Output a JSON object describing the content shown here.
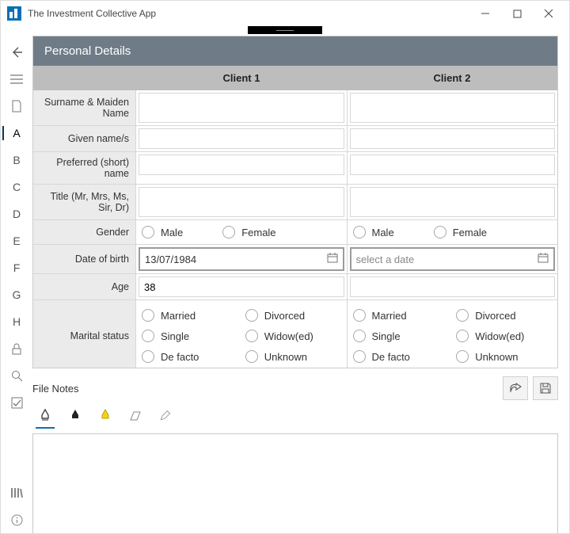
{
  "window": {
    "title": "The Investment Collective App"
  },
  "sidebar": {
    "items": [
      {
        "id": "back",
        "label": "←",
        "kind": "icon"
      },
      {
        "id": "menu",
        "label": "≡",
        "kind": "icon"
      },
      {
        "id": "page",
        "label": "▭",
        "kind": "icon"
      },
      {
        "id": "a",
        "label": "A",
        "kind": "letter",
        "selected": true
      },
      {
        "id": "b",
        "label": "B",
        "kind": "letter"
      },
      {
        "id": "c",
        "label": "C",
        "kind": "letter"
      },
      {
        "id": "d",
        "label": "D",
        "kind": "letter"
      },
      {
        "id": "e",
        "label": "E",
        "kind": "letter"
      },
      {
        "id": "f",
        "label": "F",
        "kind": "letter"
      },
      {
        "id": "g",
        "label": "G",
        "kind": "letter"
      },
      {
        "id": "h",
        "label": "H",
        "kind": "letter"
      },
      {
        "id": "lock",
        "label": "lock",
        "kind": "icon"
      },
      {
        "id": "search",
        "label": "search",
        "kind": "icon"
      },
      {
        "id": "check",
        "label": "check",
        "kind": "icon"
      },
      {
        "id": "books",
        "label": "books",
        "kind": "icon",
        "footer": true
      },
      {
        "id": "info",
        "label": "info",
        "kind": "icon",
        "footer": true
      }
    ]
  },
  "section": {
    "title": "Personal Details"
  },
  "columns": {
    "label": "",
    "c1": "Client 1",
    "c2": "Client 2"
  },
  "rows": {
    "surname": {
      "label": "Surname & Maiden Name",
      "c1": "",
      "c2": ""
    },
    "given": {
      "label": "Given name/s",
      "c1": "",
      "c2": ""
    },
    "preferred": {
      "label": "Preferred (short) name",
      "c1": "",
      "c2": ""
    },
    "title": {
      "label": "Title (Mr, Mrs, Ms, Sir, Dr)",
      "c1": "",
      "c2": ""
    },
    "gender": {
      "label": "Gender",
      "options": [
        "Male",
        "Female"
      ],
      "c1": null,
      "c2": null
    },
    "dob": {
      "label": "Date of birth",
      "c1": "13/07/1984",
      "c2_placeholder": "select a date"
    },
    "age": {
      "label": "Age",
      "c1": "38",
      "c2": ""
    },
    "marital": {
      "label": "Marital status",
      "options": [
        "Married",
        "Divorced",
        "Single",
        "Widow(ed)",
        "De facto",
        "Unknown"
      ],
      "c1": null,
      "c2": null
    }
  },
  "filenotes": {
    "title": "File Notes",
    "tools": [
      "pen-black-active",
      "pen-black",
      "highlighter",
      "eraser",
      "pencil"
    ],
    "content": ""
  }
}
